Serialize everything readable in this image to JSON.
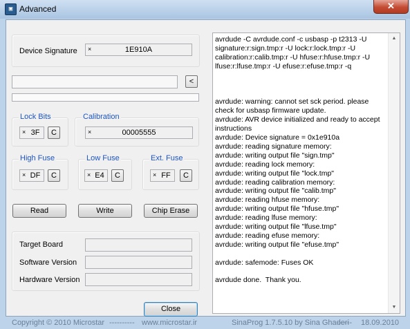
{
  "window": {
    "title": "Advanced",
    "close_glyph": "✕",
    "app_icon_glyph": "▣"
  },
  "device_signature": {
    "label": "Device Signature",
    "clear_glyph": "×",
    "value": "1E910A"
  },
  "path": {
    "value": "",
    "button_label": "<"
  },
  "progress": {
    "value": 0
  },
  "lock_bits": {
    "legend": "Lock Bits",
    "clear_glyph": "×",
    "value": "3F",
    "button_label": "C"
  },
  "calibration": {
    "legend": "Calibration",
    "clear_glyph": "×",
    "value": "00005555"
  },
  "high_fuse": {
    "legend": "High Fuse",
    "clear_glyph": "×",
    "value": "DF",
    "button_label": "C"
  },
  "low_fuse": {
    "legend": "Low Fuse",
    "clear_glyph": "×",
    "value": "E4",
    "button_label": "C"
  },
  "ext_fuse": {
    "legend": "Ext. Fuse",
    "clear_glyph": "×",
    "value": "FF",
    "button_label": "C"
  },
  "actions": {
    "read": "Read",
    "write": "Write",
    "chip_erase": "Chip Erase"
  },
  "info": {
    "target_board": {
      "label": "Target Board",
      "value": ""
    },
    "software_version": {
      "label": "Software Version",
      "value": ""
    },
    "hardware_version": {
      "label": "Hardware Version",
      "value": ""
    }
  },
  "close_button": "Close",
  "log": {
    "text": "avrdude -C avrdude.conf -c usbasp -p t2313 -U signature:r:sign.tmp:r -U lock:r:lock.tmp:r -U calibration:r:calib.tmp:r -U hfuse:r:hfuse.tmp:r -U lfuse:r:lfuse.tmp:r -U efuse:r:efuse.tmp:r -q\n\n\n\navrdude: warning: cannot set sck period. please check for usbasp firmware update.\navrdude: AVR device initialized and ready to accept instructions\navrdude: Device signature = 0x1e910a\navrdude: reading signature memory:\navrdude: writing output file \"sign.tmp\"\navrdude: reading lock memory:\navrdude: writing output file \"lock.tmp\"\navrdude: reading calibration memory:\navrdude: writing output file \"calib.tmp\"\navrdude: reading hfuse memory:\navrdude: writing output file \"hfuse.tmp\"\navrdude: reading lfuse memory:\navrdude: writing output file \"lfuse.tmp\"\navrdude: reading efuse memory:\navrdude: writing output file \"efuse.tmp\"\n\navrdude: safemode: Fuses OK\n\navrdude done.  Thank you.",
    "scroll_up_glyph": "▲",
    "scroll_down_glyph": "▼"
  },
  "statusbar": {
    "copyright": "Copyright © 2010 Microstar",
    "sep1": "----------",
    "website": "www.microstar.ir",
    "product": "SinaProg 1.7.5.10  by  Sina Ghaderi",
    "sep2": "------",
    "date": "18.09.2010"
  },
  "colors": {
    "legend": "#1e55c0",
    "frame": "#bcd3ea",
    "close_button": "#c44c34"
  }
}
